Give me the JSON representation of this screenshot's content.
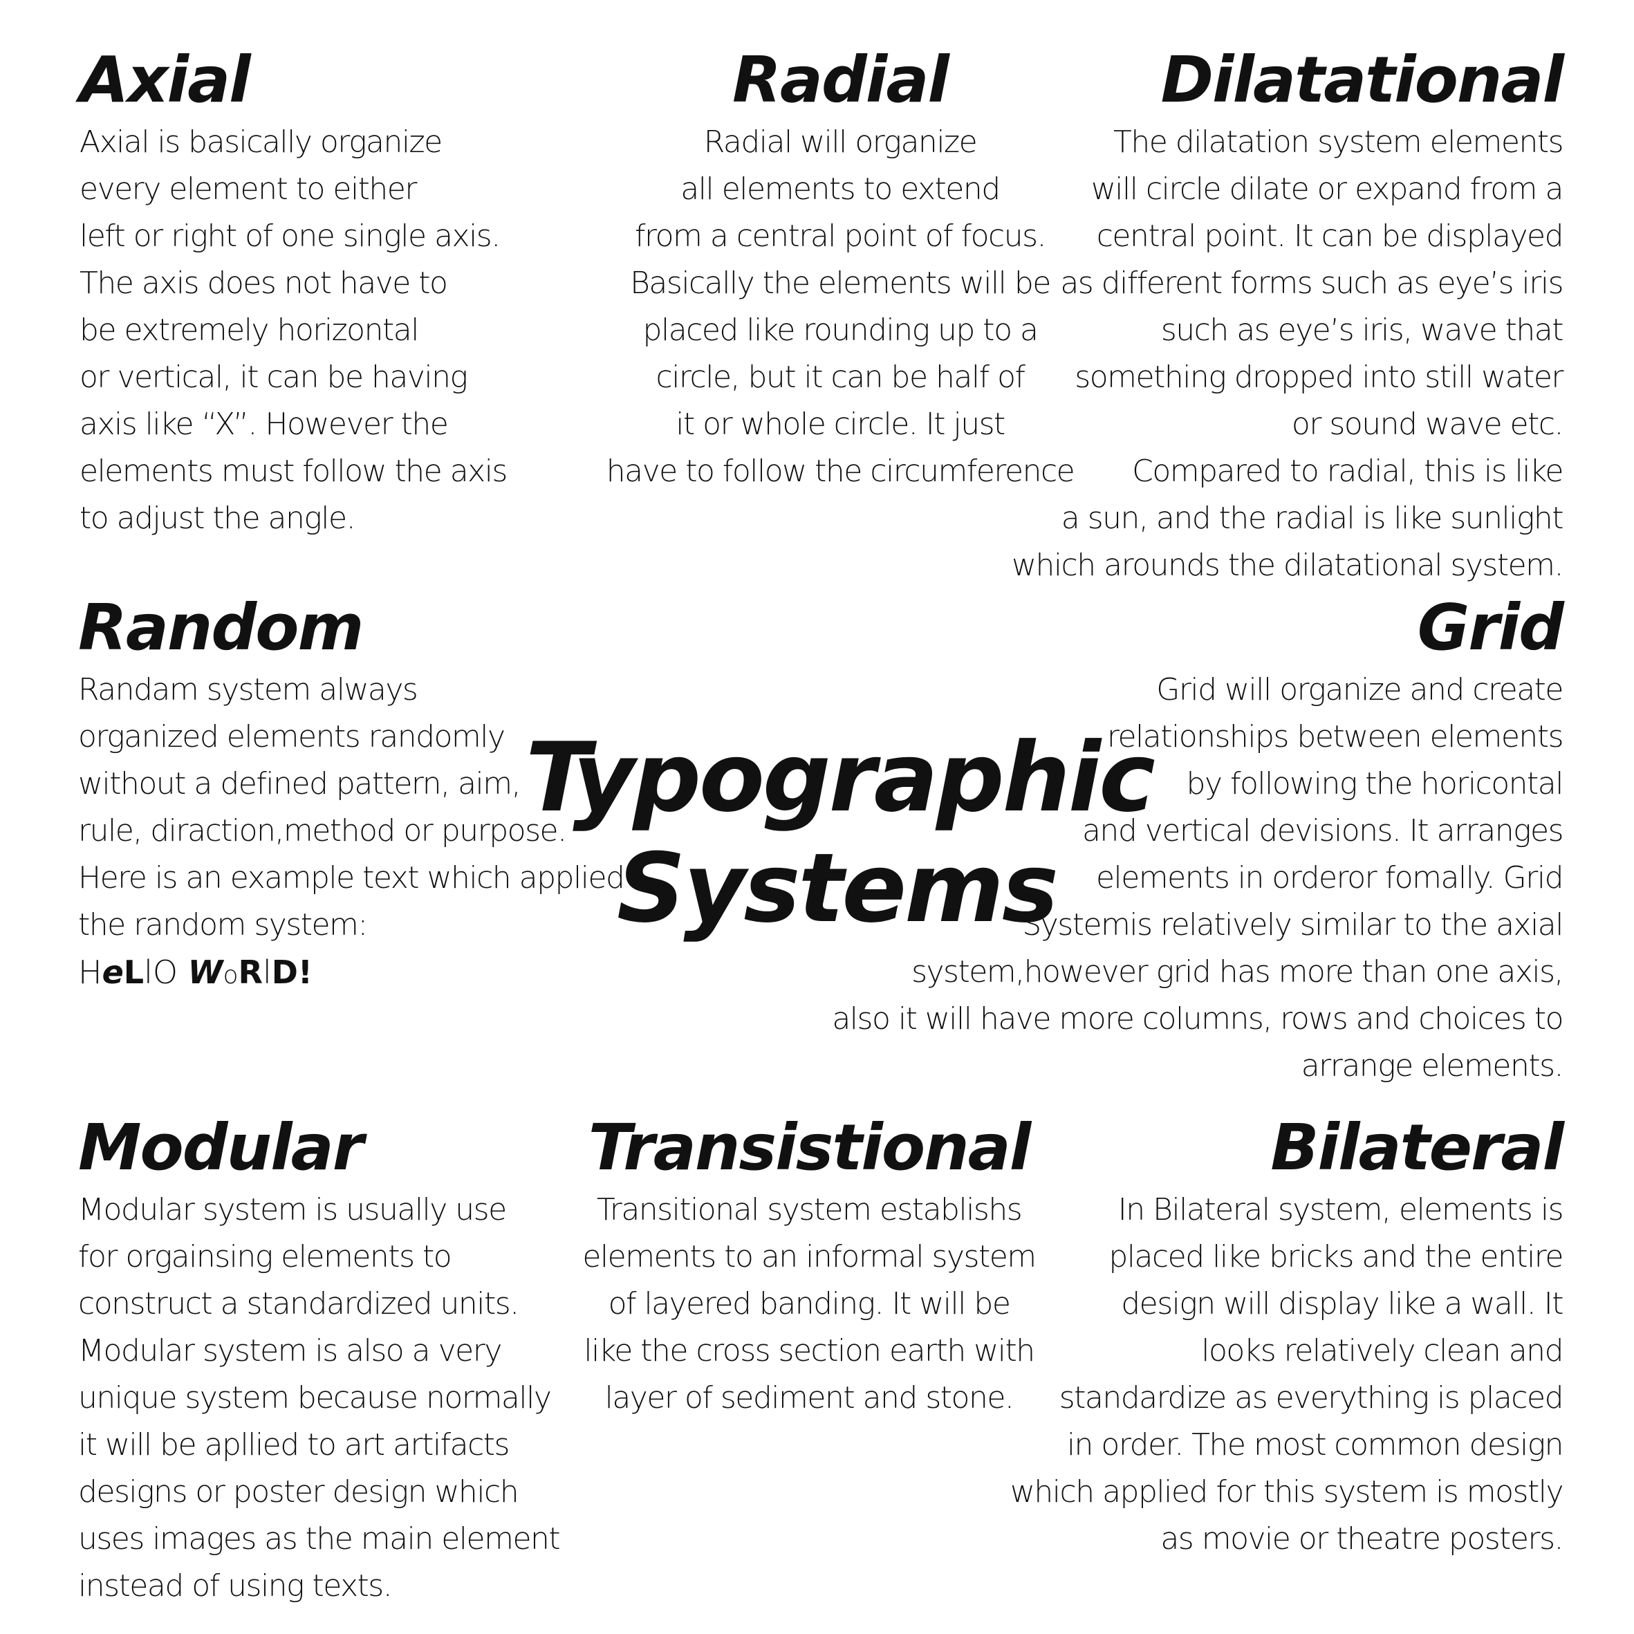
{
  "central_title": [
    "Typographic",
    "Systems"
  ],
  "sections": {
    "axial": {
      "title": "Axial",
      "lines": [
        "Axial is basically organize",
        "every element to either",
        "left or right of one single axis.",
        "The axis does not have to",
        "be extremely horizontal",
        "or vertical, it can be having",
        "axis like “X”. However the",
        "elements must follow the axis",
        "to adjust the angle."
      ]
    },
    "radial": {
      "title": "Radial",
      "lines": [
        "Radial will organize",
        "all elements to extend",
        "from a central point of focus.",
        "Basically the elements will be",
        "placed like rounding up to a",
        "circle, but it can be half of",
        "it or whole circle. It just",
        "have to follow the circumference"
      ]
    },
    "dilatational": {
      "title": "Dilatational",
      "lines": [
        "The dilatation system elements",
        "will circle dilate or expand from a",
        "central point. It can be displayed",
        "as different forms such as eye’s iris",
        "such as eye’s iris, wave that",
        "something dropped into still water",
        "or sound wave etc.",
        "Compared to radial, this is like",
        "a sun, and the radial is like sunlight",
        "which arounds the dilatational system."
      ]
    },
    "random": {
      "title": "Random",
      "lines": [
        "Randam system always",
        "organized elements randomly",
        "without a defined pattern, aim,",
        "rule, diraction,method or purpose.",
        "Here is an example text which applied",
        "the random system:"
      ],
      "example": [
        "H",
        "e",
        "L",
        "l",
        "O",
        " ",
        "W",
        "o",
        "R",
        "l",
        "D",
        "!"
      ]
    },
    "grid": {
      "title": "Grid",
      "lines": [
        "Grid will organize and create",
        "relationships between elements",
        "by following the horicontal",
        "and vertical devisions. It arranges",
        "elements in orderor fomally. Grid",
        "Systemis relatively similar to the axial",
        "system,however grid has more than one axis,",
        "also it will have more columns, rows and choices to",
        "arrange elements."
      ]
    },
    "modular": {
      "title": "Modular",
      "lines": [
        "Modular system is usually use",
        "for orgainsing elements to",
        "construct a standardized units.",
        "Modular system is also a very",
        "unique system because normally",
        "it will be apllied to art artifacts",
        "designs or poster design which",
        "uses images as the main element",
        "instead of using texts."
      ]
    },
    "transitional": {
      "title": "Transistional",
      "lines": [
        "Transitional system establishs",
        "elements to an informal system",
        "of layered banding. It will be",
        "like the cross section earth with",
        "layer of sediment and stone."
      ]
    },
    "bilateral": {
      "title": "Bilateral",
      "lines": [
        "In Bilateral system, elements is",
        "placed like bricks and the entire",
        "design will display like a wall. It",
        "looks relatively clean and",
        "standardize as everything is placed",
        "in order. The most common design",
        "which applied for this system is mostly",
        "as movie or theatre posters."
      ]
    }
  }
}
